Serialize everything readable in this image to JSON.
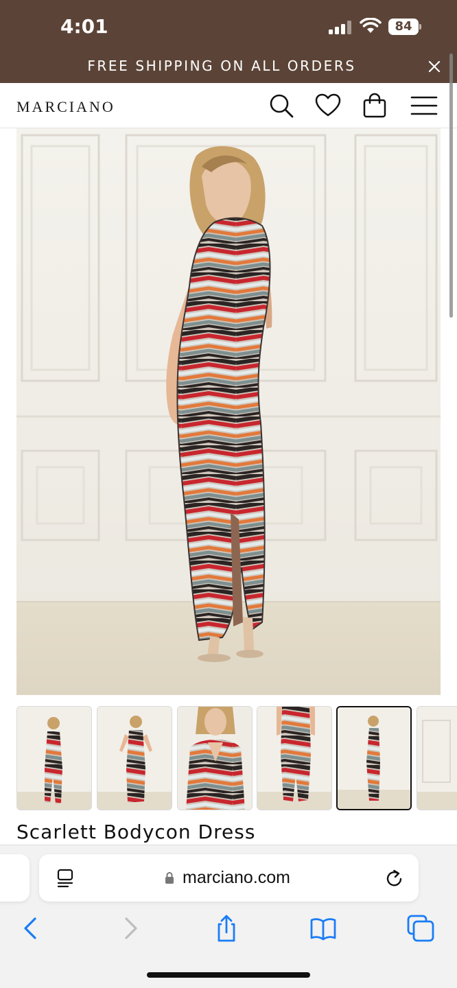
{
  "status_bar": {
    "time": "4:01",
    "battery": "84"
  },
  "promo_banner": {
    "text": "FREE SHIPPING ON ALL ORDERS",
    "close_icon": "close-icon"
  },
  "header": {
    "logo": "MARCIANO",
    "icons": [
      "search-icon",
      "heart-icon",
      "shopping-bag-icon",
      "menu-icon"
    ]
  },
  "product": {
    "title": "Scarlett Bodycon Dress",
    "thumbnail_count": 6,
    "selected_thumbnail": 5
  },
  "browser": {
    "url": "marciano.com",
    "toolbar_icons": [
      "back-icon",
      "forward-icon",
      "share-icon",
      "bookmarks-icon",
      "tabs-icon"
    ]
  },
  "colors": {
    "banner_bg": "#5b4437",
    "accent_blue": "#1a7cf5",
    "text_dark": "#111111"
  }
}
